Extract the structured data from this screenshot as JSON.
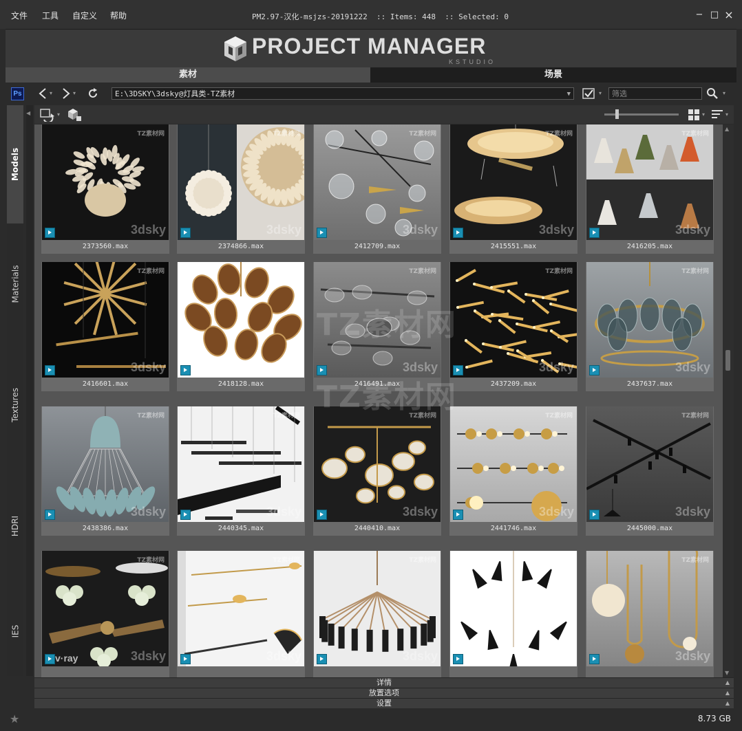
{
  "menu": [
    "文件",
    "工具",
    "自定义",
    "帮助"
  ],
  "title": {
    "app": "PM2.97-汉化-msjzs-20191222",
    "items_label": ":: Items: 448",
    "selected_label": ":: Selected: 0"
  },
  "window_controls": {
    "minimize": "−",
    "maximize": "□",
    "close": "×"
  },
  "logo": {
    "title": "PROJECT MANAGER",
    "subtitle": "KSTUDIO"
  },
  "main_tabs": [
    {
      "label": "素材",
      "active": true
    },
    {
      "label": "场景",
      "active": false
    }
  ],
  "toolbar": {
    "ps_label": "Ps",
    "path": "E:\\3DSKY\\3dsky@灯具类-TZ素材",
    "filter_placeholder": "筛选",
    "icons": [
      "photoshop-icon",
      "back-arrow-icon",
      "forward-arrow-icon",
      "refresh-icon",
      "checklist-icon",
      "search-icon"
    ]
  },
  "side_tabs": [
    {
      "label": "Models",
      "active": true
    },
    {
      "label": "Materials",
      "active": false
    },
    {
      "label": "Textures",
      "active": false
    },
    {
      "label": "HDRI",
      "active": false
    },
    {
      "label": "IES",
      "active": false
    }
  ],
  "zoom_level": 0.17,
  "items": [
    {
      "name": "2373560.max",
      "style": "feather-dark"
    },
    {
      "name": "2374866.max",
      "style": "feather-pair"
    },
    {
      "name": "2412709.max",
      "style": "bubble-branch"
    },
    {
      "name": "2415551.max",
      "style": "disc-gold"
    },
    {
      "name": "2416205.max",
      "style": "cones-color"
    },
    {
      "name": "2416601.max",
      "style": "gold-bars-dark"
    },
    {
      "name": "2418128.max",
      "style": "leaf-bronze"
    },
    {
      "name": "2416491.max",
      "style": "glass-linear"
    },
    {
      "name": "2437209.max",
      "style": "gold-sticks"
    },
    {
      "name": "2437637.max",
      "style": "ring-chandelier"
    },
    {
      "name": "2438386.max",
      "style": "shuttlecock"
    },
    {
      "name": "2440345.max",
      "style": "linear-black"
    },
    {
      "name": "2440410.max",
      "style": "glass-discs"
    },
    {
      "name": "2441746.max",
      "style": "orb-rail"
    },
    {
      "name": "2445000.max",
      "style": "track-cross"
    },
    {
      "name": "",
      "style": "fan-vray"
    },
    {
      "name": "",
      "style": "mobile-gold"
    },
    {
      "name": "",
      "style": "spike-chandelier"
    },
    {
      "name": "",
      "style": "black-cones"
    },
    {
      "name": "",
      "style": "pendant-globe"
    }
  ],
  "watermarks": {
    "thumb": "3dsky",
    "site": "TZ素材网",
    "vray": "v·ray"
  },
  "bottom_panels": [
    "详情",
    "放置选项",
    "设置"
  ],
  "status": {
    "disk_size": "8.73 GB"
  },
  "colors": {
    "background": "#2b2b2b",
    "tab_active": "#4c4c4c",
    "tab_inactive": "#1e1e1e",
    "max_badge": "#1a8fb3",
    "grid_bg": "#555555"
  }
}
